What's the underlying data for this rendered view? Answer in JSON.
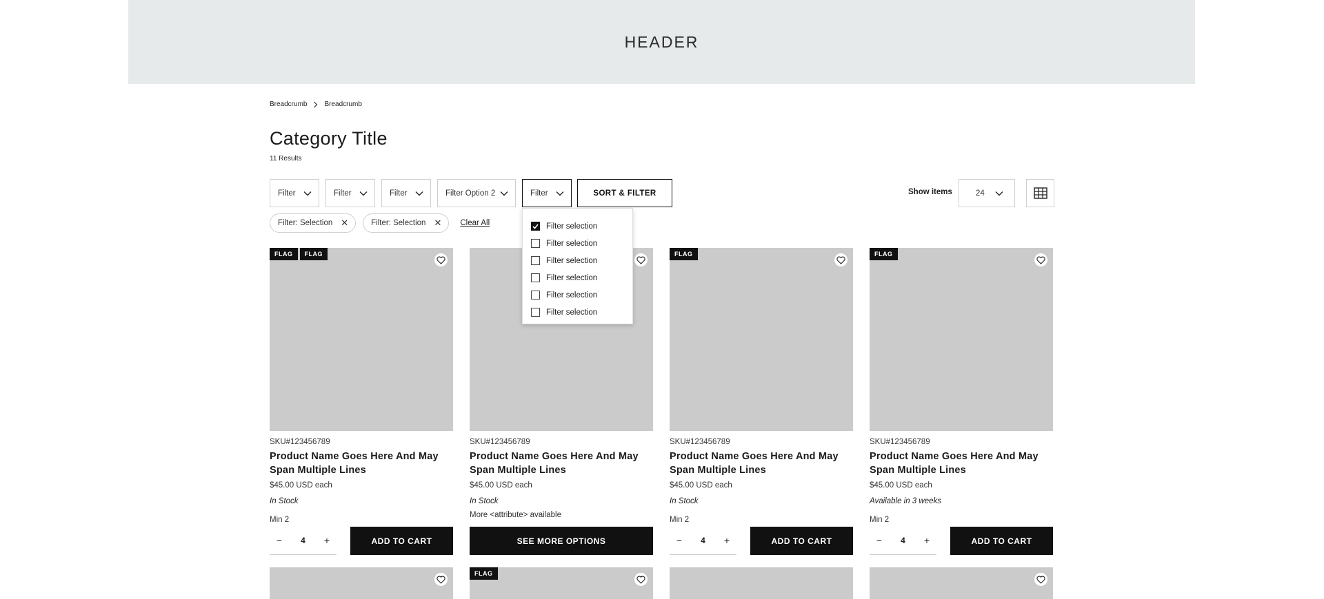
{
  "header": {
    "label": "HEADER"
  },
  "breadcrumb": [
    "Breadcrumb",
    "Breadcrumb"
  ],
  "page_title": "Category Title",
  "results": "11 Results",
  "filters": [
    {
      "label": "Filter"
    },
    {
      "label": "Filter"
    },
    {
      "label": "Filter"
    },
    {
      "label": "Filter Option 2"
    },
    {
      "label": "Filter",
      "active": true
    }
  ],
  "sort_button": "SORT & FILTER",
  "show_items": {
    "label": "Show items",
    "value": "24"
  },
  "chips": [
    {
      "label": "Filter: Selection"
    },
    {
      "label": "Filter: Selection"
    }
  ],
  "clear_all": "Clear All",
  "dropdown": {
    "options": [
      {
        "label": "Filter selection",
        "checked": true
      },
      {
        "label": "Filter selection",
        "checked": false
      },
      {
        "label": "Filter selection",
        "checked": false
      },
      {
        "label": "Filter selection",
        "checked": false
      },
      {
        "label": "Filter selection",
        "checked": false
      },
      {
        "label": "Filter selection",
        "checked": false
      }
    ]
  },
  "products": [
    {
      "flags": [
        "FLAG",
        "FLAG"
      ],
      "sku": "SKU#123456789",
      "name": "Product Name Goes Here And May Span Multiple Lines",
      "price": "$45.00 USD each",
      "stock": "In Stock",
      "min": "Min 2",
      "qty": "4",
      "button": "ADD TO CART"
    },
    {
      "flags": [],
      "sku": "SKU#123456789",
      "name": "Product Name Goes Here And May Span Multiple Lines",
      "price": "$45.00 USD each",
      "stock": "In Stock",
      "more": "More <attribute> available",
      "button": "SEE MORE OPTIONS"
    },
    {
      "flags": [
        "FLAG"
      ],
      "sku": "SKU#123456789",
      "name": "Product Name Goes Here And May Span Multiple Lines",
      "price": "$45.00 USD each",
      "stock": "In Stock",
      "min": "Min 2",
      "qty": "4",
      "button": "ADD TO CART"
    },
    {
      "flags": [
        "FLAG"
      ],
      "sku": "SKU#123456789",
      "name": "Product Name Goes Here And May Span Multiple Lines",
      "price": "$45.00 USD each",
      "stock": "Available in 3 weeks",
      "min": "Min 2",
      "qty": "4",
      "button": "ADD TO CART"
    }
  ],
  "second_row": [
    {
      "flags": []
    },
    {
      "flags": [
        "FLAG"
      ]
    },
    {
      "flags": []
    },
    {
      "flags": []
    }
  ],
  "icons": {
    "heart": "heart-icon",
    "grid": "grid-view-icon",
    "chevron": "chevron-down-icon"
  }
}
